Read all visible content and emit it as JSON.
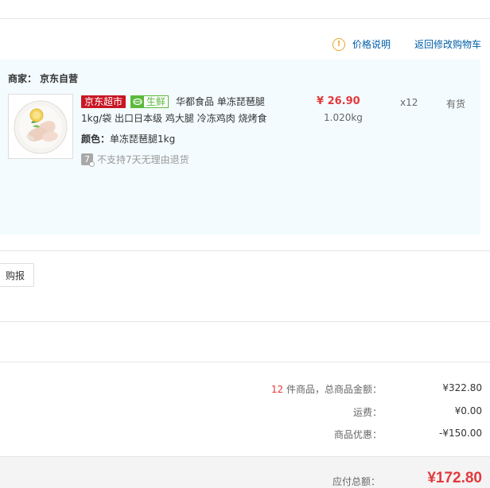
{
  "header": {
    "price_note_label": "价格说明",
    "back_to_cart_label": "返回修改购物车"
  },
  "shop": {
    "merchant_label": "商家：",
    "merchant_name": "京东自营",
    "item": {
      "badge_jd": "京东超市",
      "badge_fresh": "生鲜",
      "name_line1": "华都食品 单冻琵琶腿",
      "name_line2": "1kg/袋 出口日本级 鸡大腿 冷冻鸡肉 烧烤食",
      "color_label": "颜色：",
      "color_value": "单冻琵琶腿1kg",
      "return_icon_text": "7",
      "return_policy": "不支持7天无理由退货",
      "price": "¥ 26.90",
      "weight": "1.020kg",
      "quantity": "x12",
      "stock": "有货"
    }
  },
  "invoice": {
    "button_label": "购报销"
  },
  "summary": {
    "count": "12",
    "count_suffix": " 件商品，总商品金额：",
    "goods_total": "¥322.80",
    "shipping_label": "运费：",
    "shipping_value": "¥0.00",
    "discount_label": "商品优惠：",
    "discount_value": "-¥150.00",
    "payable_label": "应付总额：",
    "payable_value": "¥172.80"
  },
  "colors": {
    "accent_red": "#e4393c",
    "link_blue": "#005ea7",
    "fresh_green": "#5bb93b",
    "jd_red": "#c81623",
    "shop_bg": "#f3fbfe"
  }
}
